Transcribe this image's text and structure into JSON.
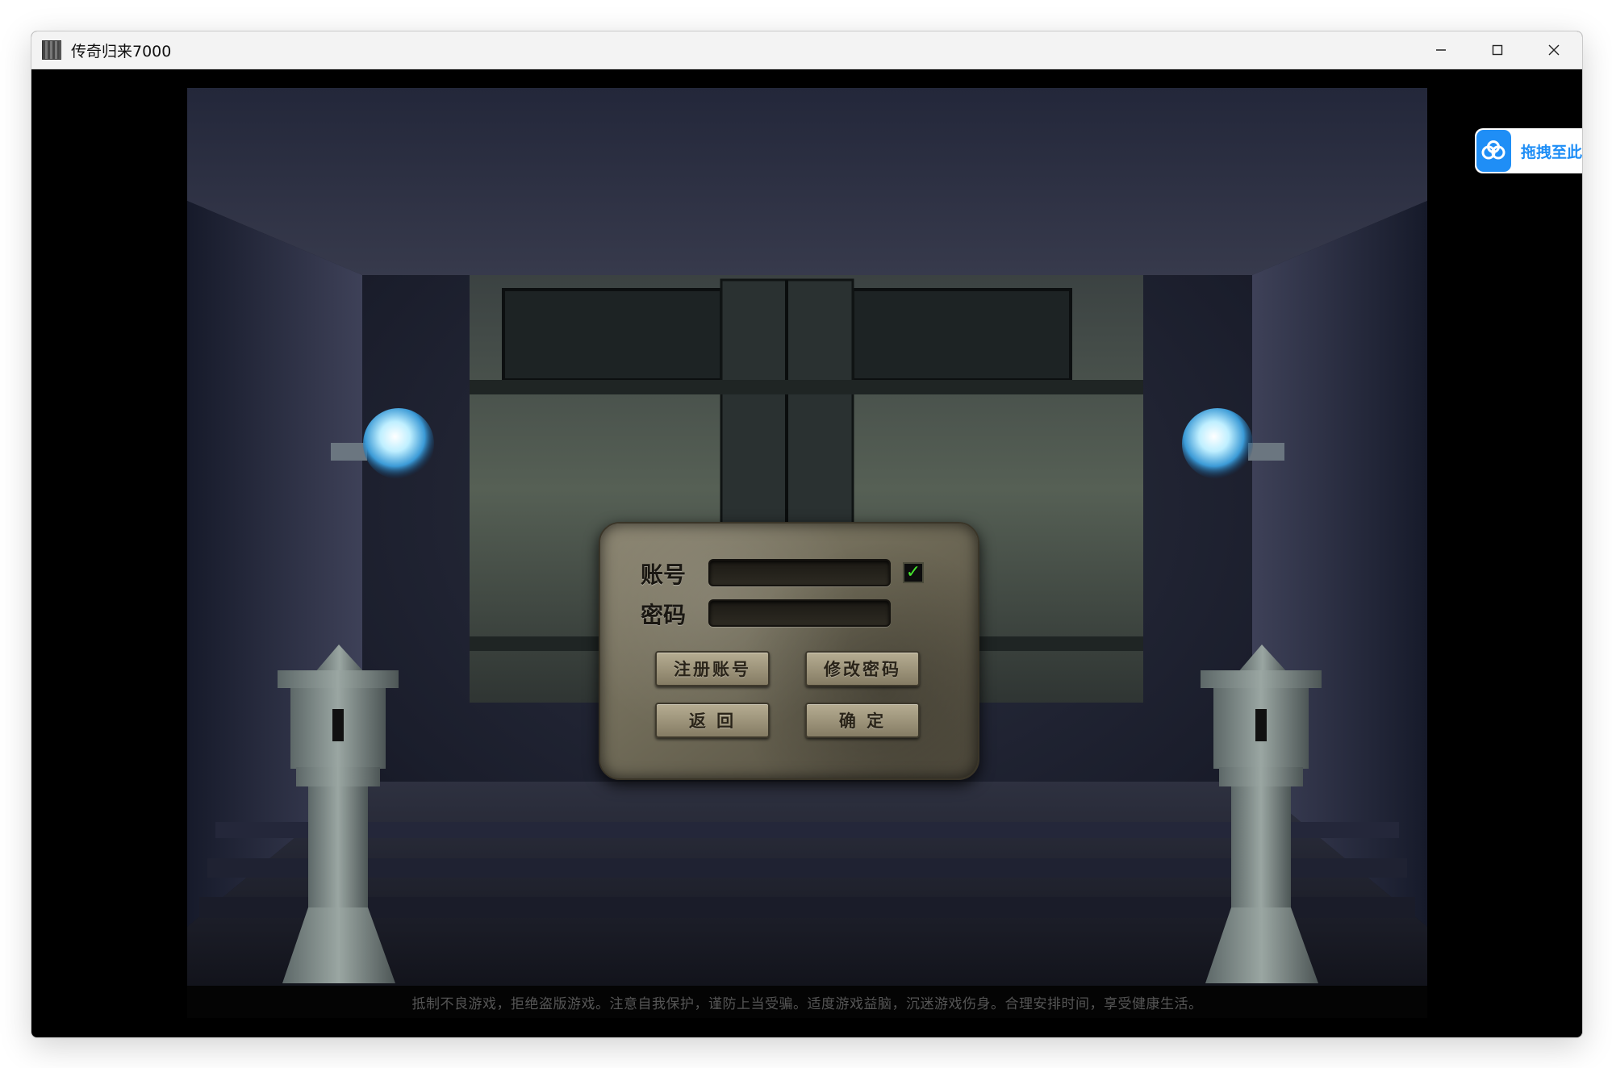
{
  "window": {
    "title": "传奇归来7000",
    "controls": {
      "minimize": "—",
      "maximize": "☐",
      "close": "✕"
    }
  },
  "login": {
    "account_label": "账号",
    "password_label": "密码",
    "account_value": "",
    "password_value": "",
    "remember_checked": true,
    "register_button": "注册账号",
    "change_password_button": "修改密码",
    "back_button": "返 回",
    "confirm_button": "确 定"
  },
  "footer": {
    "notice": "抵制不良游戏，拒绝盗版游戏。注意自我保护，谨防上当受骗。适度游戏益脑，沉迷游戏伤身。合理安排时间，享受健康生活。"
  },
  "overlay": {
    "cloud_label": "拖拽至此",
    "cloud_icon": "cloud-icon"
  },
  "colors": {
    "accent_blue": "#1f8ef6",
    "check_green": "#46e62e",
    "panel_stone": "#7a745f"
  }
}
